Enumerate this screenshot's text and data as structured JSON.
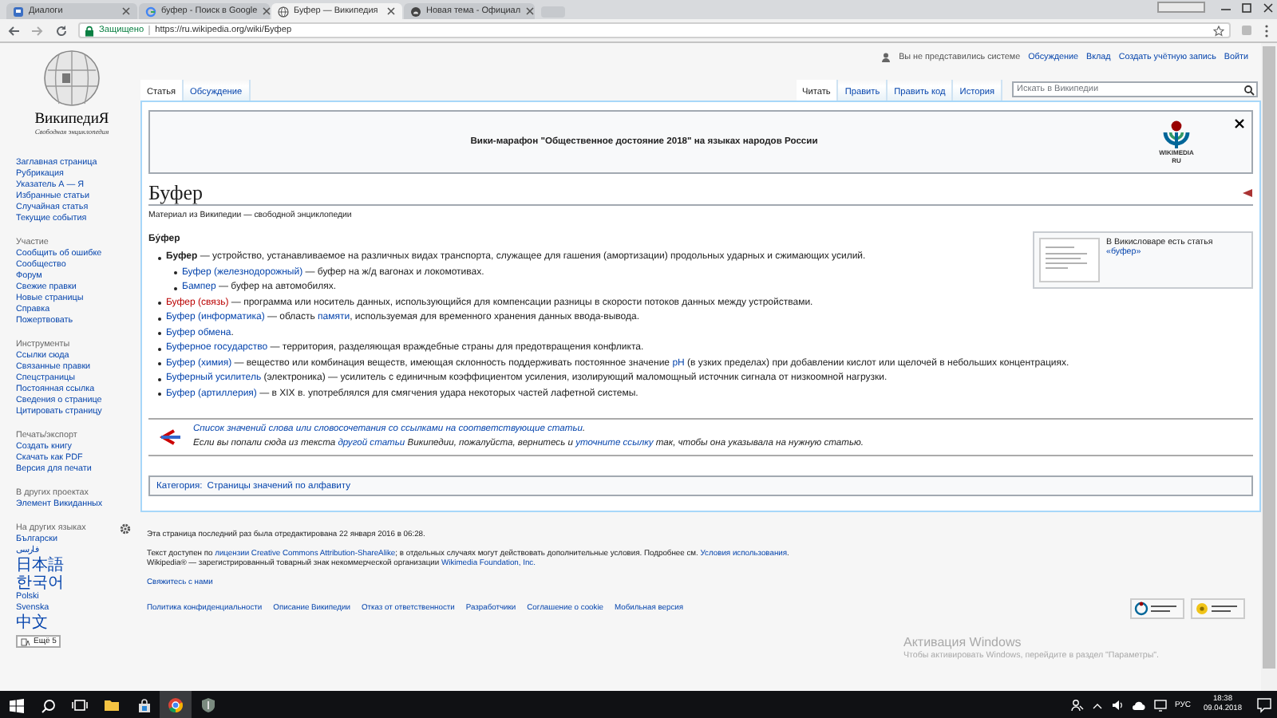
{
  "browser": {
    "tabs": [
      {
        "title": "Диалоги",
        "kind": "chat",
        "selected": false
      },
      {
        "title": "буфер - Поиск в Google",
        "kind": "search",
        "selected": false
      },
      {
        "title": "Буфер — Википедия",
        "kind": "wiki",
        "selected": true
      },
      {
        "title": "Новая тема - Официал",
        "kind": "forum",
        "selected": false
      }
    ],
    "address_bar": {
      "security_label": "Защищено",
      "url": "https://ru.wikipedia.org/wiki/Буфер"
    }
  },
  "wiki": {
    "logo": {
      "wordmark": "ВикипедиЯ",
      "tagline": "Свободная энциклопедия"
    },
    "sidebar": [
      {
        "items": [
          "Заглавная страница",
          "Рубрикация",
          "Указатель А — Я",
          "Избранные статьи",
          "Случайная статья",
          "Текущие события"
        ]
      },
      {
        "heading": "Участие",
        "items": [
          "Сообщить об ошибке",
          "Сообщество",
          "Форум",
          "Свежие правки",
          "Новые страницы",
          "Справка",
          "Пожертвовать"
        ]
      },
      {
        "heading": "Инструменты",
        "items": [
          "Ссылки сюда",
          "Связанные правки",
          "Спецстраницы",
          "Постоянная ссылка",
          "Сведения о странице",
          "Цитировать страницу"
        ]
      },
      {
        "heading": "Печать/экспорт",
        "items": [
          "Создать книгу",
          "Скачать как PDF",
          "Версия для печати"
        ]
      },
      {
        "heading": "В других проектах",
        "items": [
          "Элемент Викиданных"
        ]
      },
      {
        "heading": "На других языках",
        "settings": true,
        "items": [
          {
            "label": "Български",
            "kind": "latin"
          },
          {
            "label": "فارسی",
            "kind": "latin"
          },
          {
            "label": "日本語",
            "kind": "cjk"
          },
          {
            "label": "한국어",
            "kind": "cjk"
          },
          {
            "label": "Polski",
            "kind": "latin"
          },
          {
            "label": "Svenska",
            "kind": "latin"
          },
          {
            "label": "中文",
            "kind": "cjk"
          }
        ],
        "more": "Ещё 5"
      }
    ],
    "personal": {
      "status": "Вы не представились системе",
      "links": [
        "Обсуждение",
        "Вклад",
        "Создать учётную запись",
        "Войти"
      ]
    },
    "page_tabs": [
      {
        "label": "Статья",
        "selected": true
      },
      {
        "label": "Обсуждение",
        "selected": false
      }
    ],
    "view_tabs": [
      {
        "label": "Читать",
        "selected": true
      },
      {
        "label": "Править",
        "selected": false
      },
      {
        "label": "Править код",
        "selected": false
      },
      {
        "label": "История",
        "selected": false
      }
    ],
    "search": {
      "placeholder": "Искать в Википедии"
    },
    "banner": {
      "text": "Вики-марафон \"Общественное достояние 2018\" на языках народов России",
      "logo_text": "WIKIMEDIA",
      "logo_subtext": "RU"
    },
    "article": {
      "title": "Буфер",
      "subtitle": "Материал из Википедии — свободной энциклопедии",
      "heading": "Бу́фер",
      "wiktionary": [
        {
          "kind": "plain",
          "text": "В Викисловаре есть статья "
        },
        {
          "kind": "link",
          "text": "«буфер»"
        }
      ],
      "items": [
        {
          "segments": [
            {
              "kind": "bold",
              "text": "Буфер"
            },
            {
              "kind": "plain",
              "text": " — устройство, устанавливаемое на различных видах транспорта, служащее для гашения (амортизации) продольных ударных и сжимающих усилий."
            }
          ],
          "children": [
            {
              "segments": [
                {
                  "kind": "link",
                  "text": "Буфер (железнодорожный)"
                },
                {
                  "kind": "plain",
                  "text": " — буфер на ж/д вагонах и локомотивах."
                }
              ]
            },
            {
              "segments": [
                {
                  "kind": "link",
                  "text": "Бампер"
                },
                {
                  "kind": "plain",
                  "text": " — буфер на автомобилях."
                }
              ]
            }
          ]
        },
        {
          "segments": [
            {
              "kind": "redlink",
              "text": "Буфер (связь)"
            },
            {
              "kind": "plain",
              "text": " — программа или носитель данных, использующийся для компенсации разницы в скорости потоков данных между устройствами."
            }
          ]
        },
        {
          "segments": [
            {
              "kind": "link",
              "text": "Буфер (информатика)"
            },
            {
              "kind": "plain",
              "text": " — область "
            },
            {
              "kind": "link",
              "text": "памяти"
            },
            {
              "kind": "plain",
              "text": ", используемая для временного хранения данных ввода-вывода."
            }
          ]
        },
        {
          "segments": [
            {
              "kind": "link",
              "text": "Буфер обмена"
            },
            {
              "kind": "plain",
              "text": "."
            }
          ]
        },
        {
          "segments": [
            {
              "kind": "link",
              "text": "Буферное государство"
            },
            {
              "kind": "plain",
              "text": " — территория, разделяющая враждебные страны для предотвращения конфликта."
            }
          ]
        },
        {
          "segments": [
            {
              "kind": "link",
              "text": "Буфер (химия)"
            },
            {
              "kind": "plain",
              "text": " — вещество или комбинация веществ, имеющая склонность поддерживать постоянное значение "
            },
            {
              "kind": "link",
              "text": "pH"
            },
            {
              "kind": "plain",
              "text": " (в узких пределах) при добавлении кислот или щелочей в небольших концентрациях."
            }
          ]
        },
        {
          "segments": [
            {
              "kind": "link",
              "text": "Буферный усилитель"
            },
            {
              "kind": "plain",
              "text": " (электроника) — усилитель с единичным коэффициентом усиления, изолирующий маломощный источник сигнала от низкоомной нагрузки."
            }
          ]
        },
        {
          "segments": [
            {
              "kind": "link",
              "text": "Буфер (артиллерия)"
            },
            {
              "kind": "plain",
              "text": " — в XIX в. употреблялся для смягчения удара некоторых частей лафетной системы."
            }
          ]
        }
      ],
      "disambiguation": [
        [
          {
            "kind": "link",
            "text": "Список значений слова или словосочетания со ссылками на соответствующие статьи"
          },
          {
            "kind": "plain",
            "text": "."
          }
        ],
        [
          {
            "kind": "plain",
            "text": "Если вы попали сюда из текста "
          },
          {
            "kind": "link",
            "text": "другой статьи"
          },
          {
            "kind": "plain",
            "text": " Википедии, пожалуйста, вернитесь и "
          },
          {
            "kind": "link",
            "text": "уточните ссылку"
          },
          {
            "kind": "plain",
            "text": " так, чтобы она указывала на нужную статью."
          }
        ]
      ],
      "categories": {
        "label": "Категория:",
        "items": [
          "Страницы значений по алфавиту"
        ]
      }
    },
    "footer": {
      "last_edited": "Эта страница последний раз была отредактирована 22 января 2016 в 06:28.",
      "license": [
        {
          "kind": "plain",
          "text": "Текст доступен по "
        },
        {
          "kind": "link",
          "text": "лицензии Creative Commons Attribution-ShareAlike"
        },
        {
          "kind": "plain",
          "text": "; в отдельных случаях могут действовать дополнительные условия. Подробнее см. "
        },
        {
          "kind": "link",
          "text": "Условия использования"
        },
        {
          "kind": "plain",
          "text": "."
        }
      ],
      "trademark": [
        {
          "kind": "plain",
          "text": "Wikipedia® — зарегистрированный товарный знак некоммерческой организации "
        },
        {
          "kind": "link",
          "text": "Wikimedia Foundation, Inc."
        }
      ],
      "contact": "Свяжитесь с нами",
      "links": [
        "Политика конфиденциальности",
        "Описание Википедии",
        "Отказ от ответственности",
        "Разработчики",
        "Соглашение о cookie",
        "Мобильная версия"
      ]
    }
  },
  "taskbar": {
    "apps": [
      {
        "kind": "explorer",
        "selected": false
      },
      {
        "kind": "store",
        "selected": false
      },
      {
        "kind": "browser",
        "selected": true
      },
      {
        "kind": "shield",
        "selected": false
      }
    ],
    "language": "РУС",
    "time": "18:38",
    "date": "09.04.2018"
  },
  "activation_notice": {
    "title": "Активация Windows",
    "text": "Чтобы активировать Windows, перейдите в раздел \"Параметры\"."
  }
}
